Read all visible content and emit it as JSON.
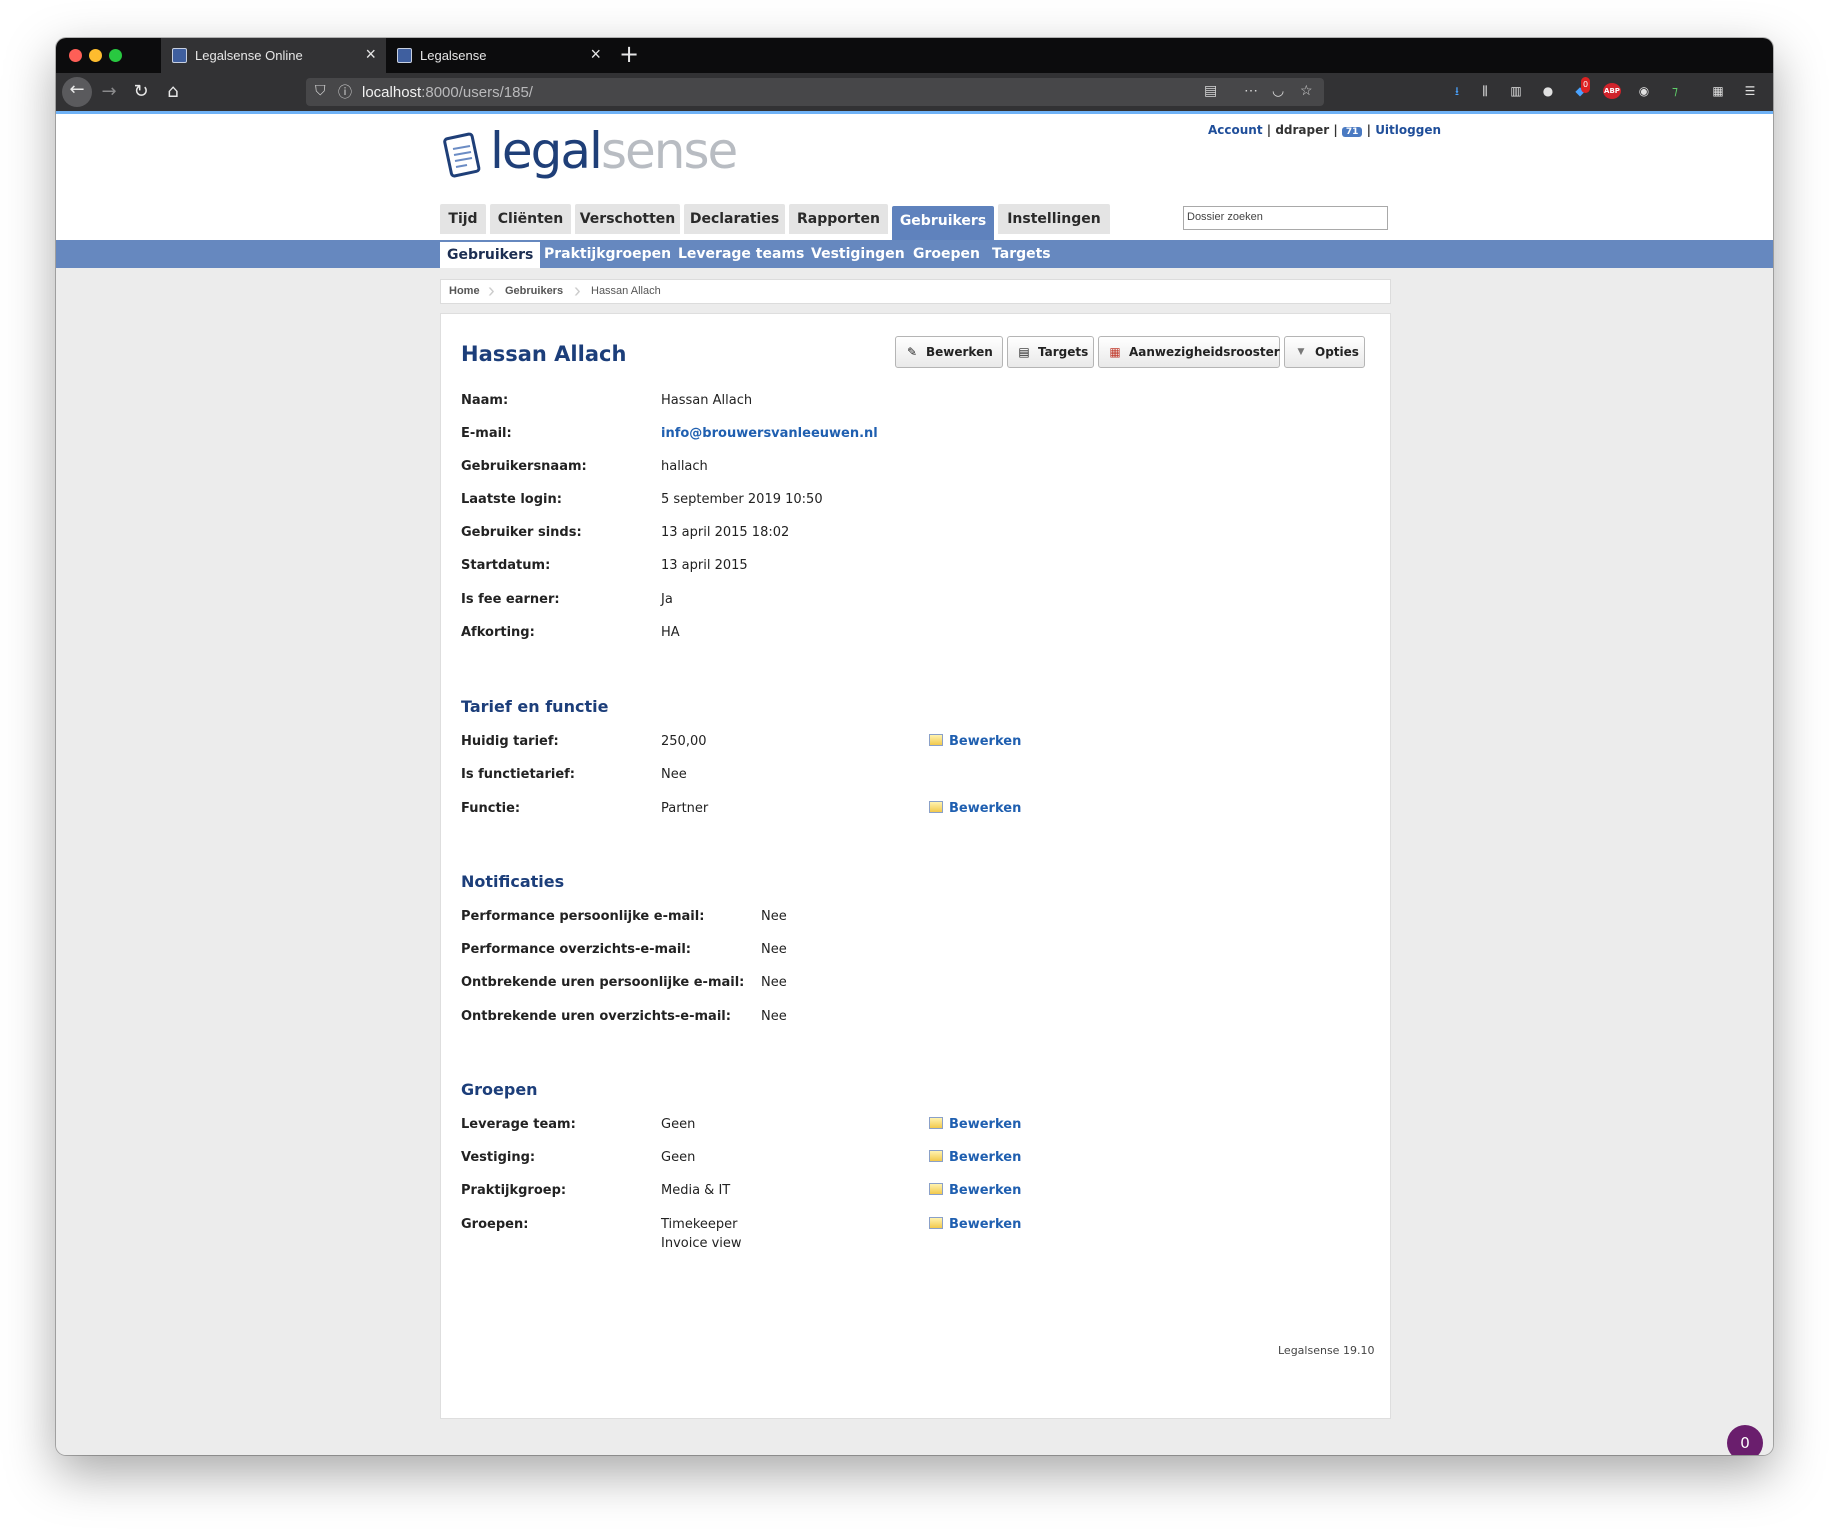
{
  "browser": {
    "tabs": [
      {
        "title": "Legalsense Online",
        "active": true
      },
      {
        "title": "Legalsense",
        "active": false
      }
    ],
    "url_host": "localhost",
    "url_rest": ":8000/users/185/",
    "ext_badge": "0",
    "abp_label": "ABP"
  },
  "header": {
    "logo_part1": "legal",
    "logo_part2": "sense",
    "account_link": "Account",
    "username": "ddraper",
    "badge_count": "71",
    "logout_link": "Uitloggen",
    "search_placeholder": "Dossier zoeken"
  },
  "main_tabs": [
    "Tijd",
    "Cliënten",
    "Verschotten",
    "Declaraties",
    "Rapporten",
    "Gebruikers",
    "Instellingen"
  ],
  "sub_nav": [
    "Gebruikers",
    "Praktijkgroepen",
    "Leverage teams",
    "Vestigingen",
    "Groepen",
    "Targets"
  ],
  "breadcrumb": [
    "Home",
    "Gebruikers",
    "Hassan Allach"
  ],
  "user": {
    "title": "Hassan Allach",
    "actions": [
      "Bewerken",
      "Targets",
      "Aanwezigheidsrooster",
      "Opties"
    ],
    "fields": [
      {
        "label": "Naam:",
        "value": "Hassan Allach"
      },
      {
        "label": "E-mail:",
        "value": "info@brouwersvanleeuwen.nl"
      },
      {
        "label": "Gebruikersnaam:",
        "value": "hallach"
      },
      {
        "label": "Laatste login:",
        "value": "5 september 2019 10:50"
      },
      {
        "label": "Gebruiker sinds:",
        "value": "13 april 2015 18:02"
      },
      {
        "label": "Startdatum:",
        "value": "13 april 2015"
      },
      {
        "label": "Is fee earner:",
        "value": "Ja"
      },
      {
        "label": "Afkorting:",
        "value": "HA"
      }
    ]
  },
  "tarief": {
    "heading": "Tarief en functie",
    "rows": [
      {
        "label": "Huidig tarief:",
        "value": "250,00",
        "edit": "Bewerken"
      },
      {
        "label": "Is functietarief:",
        "value": "Nee"
      },
      {
        "label": "Functie:",
        "value": "Partner",
        "edit": "Bewerken"
      }
    ]
  },
  "notificaties": {
    "heading": "Notificaties",
    "rows": [
      {
        "label": "Performance persoonlijke e-mail:",
        "value": "Nee"
      },
      {
        "label": "Performance overzichts-e-mail:",
        "value": "Nee"
      },
      {
        "label": "Ontbrekende uren persoonlijke e-mail:",
        "value": "Nee"
      },
      {
        "label": "Ontbrekende uren overzichts-e-mail:",
        "value": "Nee"
      }
    ]
  },
  "groepen": {
    "heading": "Groepen",
    "rows": [
      {
        "label": "Leverage team:",
        "value": "Geen",
        "edit": "Bewerken"
      },
      {
        "label": "Vestiging:",
        "value": "Geen",
        "edit": "Bewerken"
      },
      {
        "label": "Praktijkgroep:",
        "value": "Media & IT",
        "edit": "Bewerken"
      },
      {
        "label": "Groepen:",
        "value": "Timekeeper",
        "value2": "Invoice view",
        "edit": "Bewerken"
      }
    ]
  },
  "footer": {
    "version": "Legalsense 19.10"
  },
  "chat": {
    "count": "0"
  }
}
